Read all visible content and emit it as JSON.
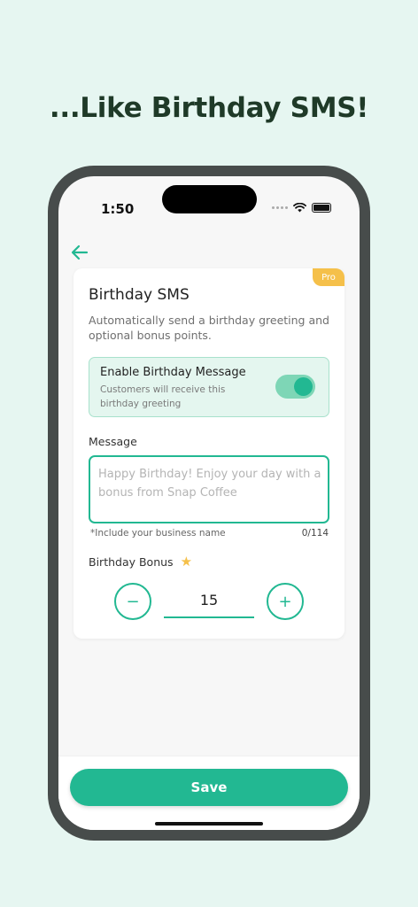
{
  "headline": "...Like Birthday SMS!",
  "status_bar": {
    "time": "1:50"
  },
  "card": {
    "badge": "Pro",
    "title": "Birthday SMS",
    "description": "Automatically send a birthday greeting and optional bonus points.",
    "enable": {
      "title": "Enable Birthday Message",
      "subtitle": "Customers will receive this birthday greeting",
      "enabled": true
    },
    "message": {
      "label": "Message",
      "placeholder": "Happy Birthday! Enjoy your day with a bonus from Snap Coffee",
      "value": "",
      "hint": "*Include your business name",
      "counter": "0/114"
    },
    "bonus": {
      "label": "Birthday Bonus",
      "icon": "star-icon",
      "value": "15",
      "decrement_label": "−",
      "increment_label": "+"
    }
  },
  "save_label": "Save",
  "colors": {
    "accent": "#22b892",
    "badge": "#f5c04a",
    "background": "#e6f6f1",
    "headline": "#1f3a28"
  }
}
